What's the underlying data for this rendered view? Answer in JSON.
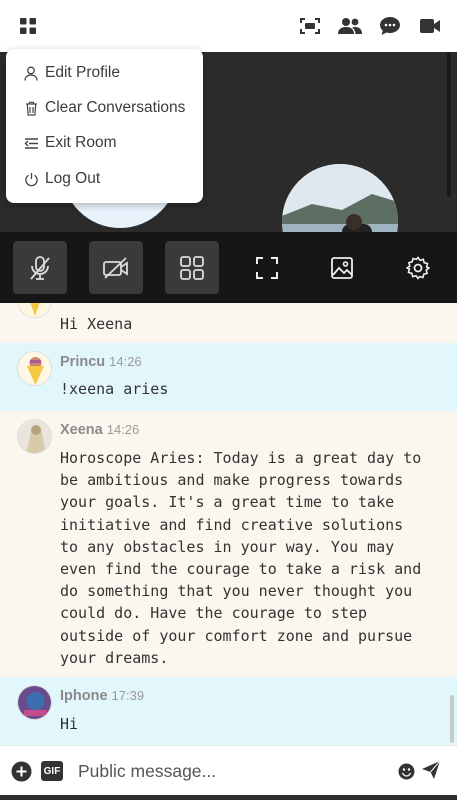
{
  "topbar": {
    "menu_icon": "grid-icon",
    "actions": [
      "screen-icon",
      "users-icon",
      "chat-icon",
      "video-icon"
    ]
  },
  "menu": {
    "items": [
      {
        "label": "Edit Profile",
        "icon": "user-icon"
      },
      {
        "label": "Clear Conversations",
        "icon": "trash-icon"
      },
      {
        "label": "Exit Room",
        "icon": "exit-icon"
      },
      {
        "label": "Log Out",
        "icon": "power-icon"
      }
    ]
  },
  "controls": [
    "mic-off-icon",
    "camera-off-icon",
    "layout-grid-icon",
    "fullscreen-icon",
    "image-icon",
    "settings-icon"
  ],
  "messages": [
    {
      "name": "",
      "time": "",
      "text": "Hi Xeena"
    },
    {
      "name": "Princu",
      "time": "14:26",
      "text": "!xeena aries"
    },
    {
      "name": "Xeena",
      "time": "14:26",
      "text": "Horoscope Aries: Today is a great day to\nbe ambitious and make progress towards\nyour goals. It's a great time to take\ninitiative and find creative solutions\nto any obstacles in your way. You may\neven find the courage to take a risk and\ndo something that you never thought you\ncould do. Have the courage to step\noutside of your comfort zone and pursue\nyour dreams."
    },
    {
      "name": "Iphone",
      "time": "17:39",
      "text": "Hi"
    }
  ],
  "input": {
    "placeholder": "Public message...",
    "gif_label": "GIF"
  },
  "colors": {
    "topbar_bg": "#ffffff",
    "video_bg": "#2b2b2b",
    "controls_bg": "#161616",
    "msg_cream": "#fcf7ee",
    "msg_blue": "#e2f7fb"
  }
}
